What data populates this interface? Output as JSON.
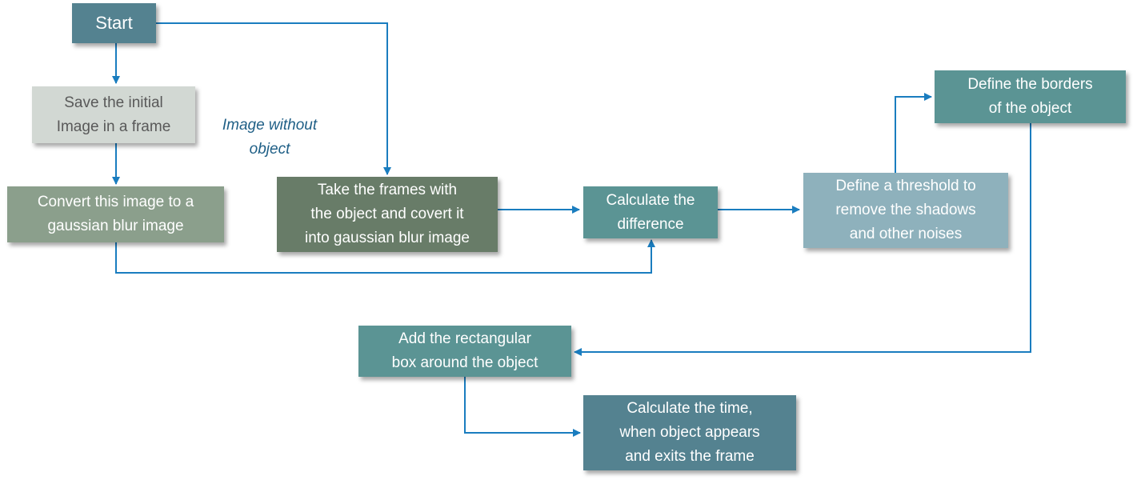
{
  "diagram": {
    "type": "flowchart",
    "line_color": "#1a7dbf",
    "nodes": [
      {
        "id": "start",
        "label": "Start",
        "color": "#548290",
        "text_color": "#ffffff"
      },
      {
        "id": "save_initial",
        "label": "Save the initial\nImage in a frame",
        "color": "#d2d8d3",
        "text_color": "#595959"
      },
      {
        "id": "convert_blur",
        "label": "Convert this image to a\ngaussian blur image",
        "color": "#8b9f8c",
        "text_color": "#ffffff"
      },
      {
        "id": "take_frames",
        "label": "Take the frames with\nthe object and covert it\ninto gaussian blur image",
        "color": "#687c68",
        "text_color": "#ffffff"
      },
      {
        "id": "calc_diff",
        "label": "Calculate the\ndifference",
        "color": "#5b9494",
        "text_color": "#ffffff"
      },
      {
        "id": "threshold",
        "label": "Define a threshold to\nremove the shadows\nand other noises",
        "color": "#8eb1bc",
        "text_color": "#ffffff"
      },
      {
        "id": "borders",
        "label": "Define the borders\nof the object",
        "color": "#5b9494",
        "text_color": "#ffffff"
      },
      {
        "id": "add_box",
        "label": "Add the rectangular\nbox around the object",
        "color": "#5b9494",
        "text_color": "#ffffff"
      },
      {
        "id": "calc_time",
        "label": "Calculate the time,\nwhen object appears\nand exits the frame",
        "color": "#548290",
        "text_color": "#ffffff"
      }
    ],
    "annotations": [
      {
        "id": "image_without_object",
        "text": "Image without\nobject",
        "color": "#1f5f86"
      }
    ],
    "edges": [
      {
        "from": "start",
        "to": "save_initial"
      },
      {
        "from": "start",
        "to": "take_frames"
      },
      {
        "from": "save_initial",
        "to": "convert_blur"
      },
      {
        "from": "convert_blur",
        "to": "calc_diff"
      },
      {
        "from": "take_frames",
        "to": "calc_diff"
      },
      {
        "from": "calc_diff",
        "to": "threshold"
      },
      {
        "from": "threshold",
        "to": "borders"
      },
      {
        "from": "borders",
        "to": "add_box"
      },
      {
        "from": "add_box",
        "to": "calc_time"
      }
    ]
  }
}
